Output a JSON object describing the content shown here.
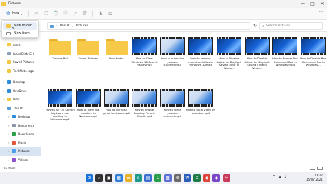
{
  "window": {
    "title": "Pictures",
    "controls": [
      "—",
      "□",
      "✕"
    ]
  },
  "toolbar": {
    "new_label": "New",
    "icons": [
      "cut-icon",
      "copy-icon",
      "paste-icon",
      "rename-icon",
      "share-icon",
      "delete-icon",
      "sort-icon",
      "view-icon"
    ],
    "sort_glyph": "⇅",
    "view_glyph": "▭",
    "more_glyph": "···"
  },
  "new_menu": {
    "items": [
      "New folder",
      "New item"
    ],
    "hover_index": 0
  },
  "address": {
    "crumbs": [
      "This PC",
      "Pictures"
    ],
    "separator": "›",
    "refresh_glyph": "↻"
  },
  "search": {
    "placeholder": "Search Pictures",
    "glyph": "⌕"
  },
  "nav": {
    "items": [
      {
        "label": "Loca",
        "color": "#7a8ea8",
        "chev": "",
        "indent": false
      },
      {
        "label": "camt",
        "color": "#f2c744",
        "chev": "",
        "indent": false
      },
      {
        "label": "Local Disk (C:)",
        "color": "#8aa0b8",
        "chev": "",
        "indent": false
      },
      {
        "label": "Saved Pictures",
        "color": "#f2c744",
        "chev": "",
        "indent": false
      },
      {
        "label": "TechMoto logo",
        "color": "#f2c744",
        "chev": "",
        "indent": false
      },
      {
        "gap": true
      },
      {
        "label": "Desktop",
        "color": "#2e8bd8",
        "chev": "›",
        "indent": false
      },
      {
        "label": "OneDrive",
        "color": "#2e8bd8",
        "chev": "›",
        "indent": false
      },
      {
        "label": "User",
        "color": "#f2c744",
        "chev": "›",
        "indent": false
      },
      {
        "label": "This PC",
        "color": "#5a9be0",
        "chev": "⌄",
        "indent": false
      },
      {
        "label": "Desktop",
        "color": "#2e8bd8",
        "chev": "›",
        "indent": true
      },
      {
        "label": "Documents",
        "color": "#8a97a8",
        "chev": "›",
        "indent": true
      },
      {
        "label": "Downloads",
        "color": "#2ba14a",
        "chev": "›",
        "indent": true
      },
      {
        "label": "Music",
        "color": "#e2573d",
        "chev": "›",
        "indent": true
      },
      {
        "label": "Pictures",
        "color": "#4b9ee8",
        "chev": "›",
        "indent": true,
        "selected": true
      },
      {
        "label": "Videos",
        "color": "#8b4fd0",
        "chev": "›",
        "indent": true
      },
      {
        "label": "Local Disk (C:)",
        "color": "#8aa0b8",
        "chev": "›",
        "indent": true
      }
    ]
  },
  "items": [
    {
      "name": "Camera Roll",
      "kind": "folder"
    },
    {
      "name": "Saved Pictures",
      "kind": "folder"
    },
    {
      "name": "New folder",
      "kind": "folder"
    },
    {
      "name": "How to Clear Windows 10 Search History.mp4",
      "kind": "video"
    },
    {
      "name": "how to subscribe youtube channel.mp4",
      "kind": "video",
      "light": true
    },
    {
      "name": "how to remove recent activities in Windows 10.mp4",
      "kind": "video"
    },
    {
      "name": "How to Disable Adjust for Daylight Saving Time in Windo...",
      "kind": "video"
    },
    {
      "name": "How to Disable Adjust for Daylight Saving Time in Windo...",
      "kind": "video"
    },
    {
      "name": "How to Enable Run Command Box in Windows.mp4",
      "kind": "video"
    },
    {
      "name": "How to Disable Run Command Box in Windows...",
      "kind": "video"
    },
    {
      "name": "How to Fix On Screen keyboard not working in Windows.mp4",
      "kind": "video"
    },
    {
      "name": "How To View line numbers in Notepad.mp4",
      "kind": "video"
    },
    {
      "name": "how to increase gmail text size.mp4",
      "kind": "video",
      "light": true
    },
    {
      "name": "how to enable Reading Pane in Gmail.mp4",
      "kind": "video",
      "light": true
    },
    {
      "name": "how to join a youtube channel.mp4",
      "kind": "video",
      "light": true
    },
    {
      "name": "how to flip a video on youtube.mp4",
      "kind": "video",
      "light": true
    }
  ],
  "status": {
    "count": "16 items"
  },
  "taskbar": {
    "apps": [
      {
        "name": "start-icon",
        "glyph": "⊞",
        "color": "#1a73d9"
      },
      {
        "name": "search-icon",
        "glyph": "⌕",
        "color": "#333333"
      },
      {
        "name": "task-view-icon",
        "glyph": "▣",
        "color": "#333333"
      },
      {
        "name": "widgets-icon",
        "glyph": "▦",
        "color": "#2f7fd6"
      },
      {
        "name": "explorer-icon",
        "glyph": "▬",
        "color": "#e8b12a"
      },
      {
        "name": "edge-icon",
        "glyph": "e",
        "color": "#1f9a8a"
      },
      {
        "name": "store-icon",
        "glyph": "▤",
        "color": "#3a6fd0"
      },
      {
        "name": "camtasia-icon",
        "glyph": "C",
        "color": "#2a9d4b"
      },
      {
        "name": "photos-icon",
        "glyph": "▩",
        "color": "#5b6fd6"
      },
      {
        "name": "settings-icon",
        "glyph": "⚙",
        "color": "#6b6b6b"
      },
      {
        "name": "word-icon",
        "glyph": "W",
        "color": "#2b5eb8"
      },
      {
        "name": "excel-icon",
        "glyph": "X",
        "color": "#1e7b45"
      },
      {
        "name": "chrome-icon",
        "glyph": "◉",
        "color": "#db4437"
      },
      {
        "name": "app-icon",
        "glyph": "◆",
        "color": "#7a46c8"
      },
      {
        "name": "snip-icon",
        "glyph": "✂",
        "color": "#c83a5a"
      }
    ],
    "tray": [
      "^",
      "☁",
      "♪"
    ],
    "time": "13:27",
    "date": "15/07/2021"
  }
}
